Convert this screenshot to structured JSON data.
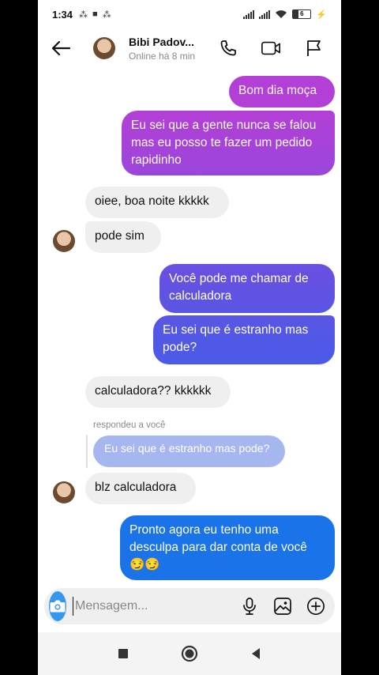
{
  "status": {
    "time": "1:34",
    "battery": "6"
  },
  "header": {
    "name": "Bibi Padov...",
    "subtitle": "Online há 8 min"
  },
  "messages": {
    "m1": "Bom dia moça",
    "m2": "Eu sei que a gente nunca se falou mas eu posso te fazer um pedido rapidinho",
    "m3": "oiee, boa noite kkkkk",
    "m4": "pode sim",
    "m5": "Você pode me chamar de calculadora",
    "m6": "Eu sei que é estranho mas pode?",
    "m7": "calculadora?? kkkkkk",
    "reply_label": "respondeu a você",
    "reply_quote": "Eu sei que é estranho mas pode?",
    "m8": "blz calculadora",
    "m9": "Pronto agora eu tenho uma desculpa para dar conta de você",
    "m9_emoji": "😏😏"
  },
  "composer": {
    "placeholder": "Mensagem..."
  },
  "colors": {
    "gradient_top": "#b43fd6",
    "gradient_mid": "#6a4fe0",
    "gradient_bottom": "#1a73e8",
    "accent": "#3797f0"
  },
  "icons": [
    "back-arrow-icon",
    "phone-icon",
    "video-icon",
    "flag-icon",
    "camera-icon",
    "mic-icon",
    "gallery-icon",
    "plus-icon",
    "nav-square-icon",
    "nav-circle-icon",
    "nav-back-icon"
  ]
}
